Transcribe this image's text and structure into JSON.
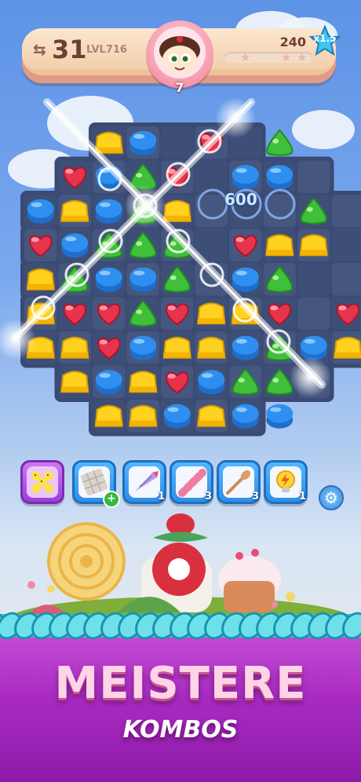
{
  "hud": {
    "moves_left": "31",
    "level": "LVL716",
    "goal_count": "7",
    "score": "240",
    "multiplier": "x1.5",
    "progress": 0.0
  },
  "board": {
    "floating_score": "600",
    "colors": {
      "red": "#e8334c",
      "blue": "#2f8ff0",
      "green": "#3fbf3a",
      "yellow": "#ffd21f",
      "tray": "#3a4a72"
    }
  },
  "boosters": [
    {
      "icon": "chick-squad-icon",
      "count": "",
      "selected": true
    },
    {
      "icon": "chocolate-bar-icon",
      "count": "+",
      "selected": false
    },
    {
      "icon": "piping-bag-icon",
      "count": "1",
      "selected": false
    },
    {
      "icon": "candy-cane-icon",
      "count": "3",
      "selected": false
    },
    {
      "icon": "wooden-spoon-icon",
      "count": "3",
      "selected": false
    },
    {
      "icon": "lightning-bulb-icon",
      "count": "1",
      "selected": false
    }
  ],
  "settings_icon": "gear-icon",
  "banner": {
    "headline": "MEISTERE",
    "subline": "KOMBOS"
  }
}
